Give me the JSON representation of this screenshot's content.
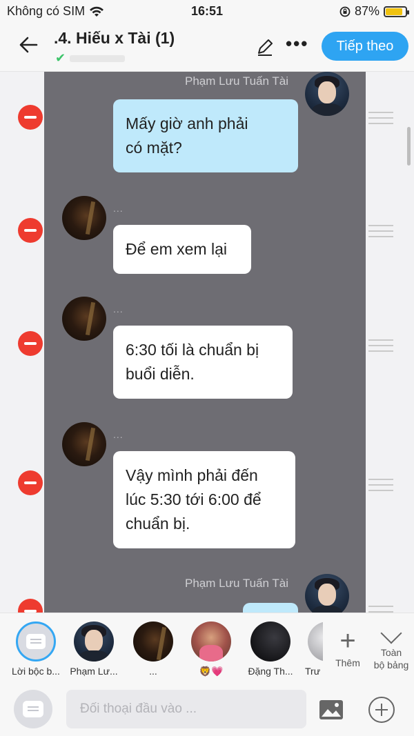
{
  "status_bar": {
    "carrier": "Không có SIM",
    "time": "16:51",
    "battery_percent": "87%",
    "battery_level": 0.87,
    "battery_color": "#f0c20f"
  },
  "header": {
    "title": ".4. Hiếu x Tài (1)",
    "next_label": "Tiếp theo",
    "accent_color": "#2ea4f2"
  },
  "messages": [
    {
      "side": "out",
      "sender": "Phạm Lưu Tuấn Tài",
      "text_lines": [
        "Mấy giờ anh phải",
        "có mặt?"
      ]
    },
    {
      "side": "in",
      "sender": "...",
      "text_lines": [
        "Để em xem lại"
      ]
    },
    {
      "side": "in",
      "sender": "...",
      "text_lines": [
        "6:30 tối là chuẩn bị",
        "buổi diễn."
      ]
    },
    {
      "side": "in",
      "sender": "...",
      "text_lines": [
        "Vậy mình phải đến",
        "lúc 5:30 tới 6:00 để",
        "chuẩn bị."
      ]
    },
    {
      "side": "out",
      "sender": "Phạm Lưu Tuấn Tài",
      "text_lines": []
    }
  ],
  "participants": [
    {
      "label": "Lời bộc b...",
      "icon": "narration-icon"
    },
    {
      "label": "Phạm Lư...",
      "icon": "avatar-man"
    },
    {
      "label": "...",
      "icon": "avatar-dark"
    },
    {
      "label": "🦁💗",
      "icon": "avatar-pink"
    },
    {
      "label": "Đặng Th...",
      "icon": "avatar-night"
    },
    {
      "label": "Trư",
      "icon": "avatar-gray"
    }
  ],
  "strip_actions": {
    "add_label": "Thêm",
    "collapse_label_1": "Toàn",
    "collapse_label_2": "bộ bảng"
  },
  "input": {
    "placeholder": "Đối thoại đầu vào ..."
  }
}
